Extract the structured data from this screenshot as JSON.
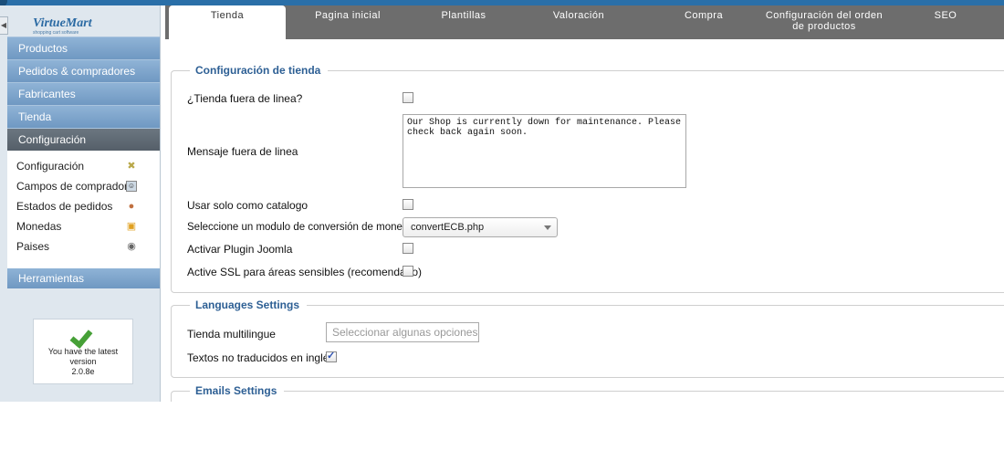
{
  "sidebar": {
    "logo": "VirtueMart",
    "logo_sub": "shopping cart software",
    "nav": [
      "Productos",
      "Pedidos & compradores",
      "Fabricantes",
      "Tienda",
      "Configuración"
    ],
    "submenu": [
      {
        "label": "Configuración",
        "icon": "wrench-icon"
      },
      {
        "label": "Campos de comprador",
        "icon": "user-fields-icon"
      },
      {
        "label": "Estados de pedidos",
        "icon": "order-status-icon"
      },
      {
        "label": "Monedas",
        "icon": "coins-icon"
      },
      {
        "label": "Paises",
        "icon": "globe-icon"
      }
    ],
    "tools": "Herramientas",
    "version_box": {
      "line1": "You have the latest",
      "line2": "version",
      "version": "2.0.8e"
    }
  },
  "tabs": [
    "Tienda",
    "Pagina inicial",
    "Plantillas",
    "Valoración",
    "Compra",
    "Configuración del orden de productos",
    "SEO"
  ],
  "tab_line2": "de productos",
  "tab_line1_6": "Configuración del orden",
  "shop": {
    "legend": "Configuración de tienda",
    "offline_label": "¿Tienda fuera de linea?",
    "offline_checked": false,
    "message_label": "Mensaje fuera de linea",
    "message_value": "Our Shop is currently down for maintenance. Please check back again soon.",
    "catalog_label": "Usar solo como catalogo",
    "currency_label": "Seleccione un modulo de conversión de moneda",
    "currency_value": "convertECB.php",
    "joomla_label": "Activar Plugin Joomla",
    "ssl_label": "Active SSL para áreas sensibles (recomendado)"
  },
  "languages": {
    "legend": "Languages Settings",
    "multi_label": "Tienda multilingue",
    "multi_placeholder": "Seleccionar algunas opciones",
    "untranslated_label": "Textos no traducidos en inglés",
    "untranslated_checked": true
  },
  "emails": {
    "legend": "Emails Settings"
  },
  "colors": {
    "accent": "#2d5f94",
    "tabbar": "#6d6d6d",
    "nav": "#7fa6cc"
  }
}
